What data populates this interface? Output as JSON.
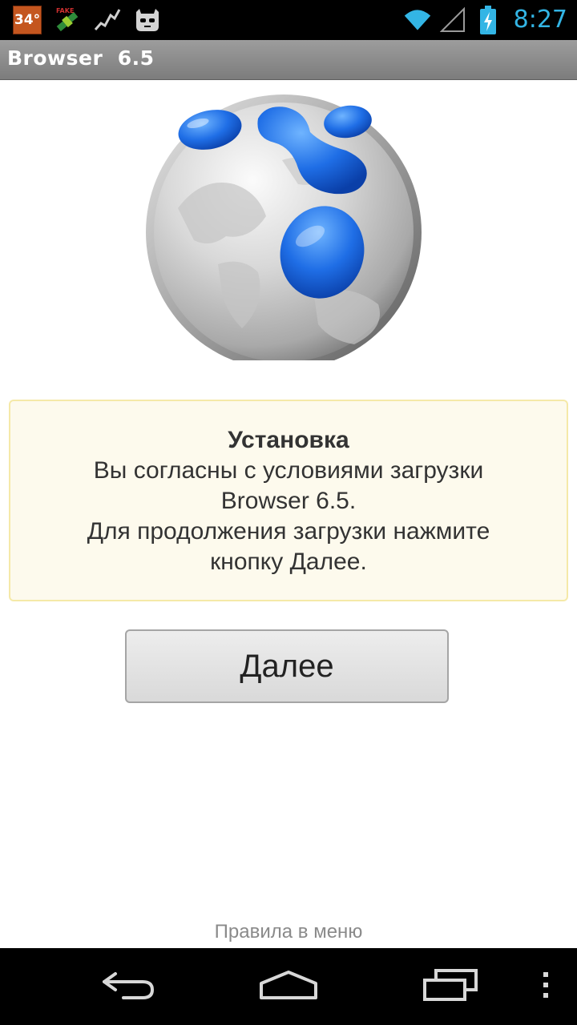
{
  "status_bar": {
    "temperature": "34°",
    "time": "8:27",
    "icons": [
      "temperature-badge",
      "fake-gps-satellite-icon",
      "activity-graph-icon",
      "cyanogenmod-mascot-icon",
      "wifi-icon",
      "cell-signal-icon",
      "battery-charging-icon"
    ]
  },
  "app": {
    "title": "Browser  6.5"
  },
  "info": {
    "title": "Установка",
    "lines": [
      "Вы согласны с условиями загрузки",
      "Browser 6.5.",
      "Для продолжения загрузки нажмите",
      "кнопку Далее."
    ]
  },
  "actions": {
    "next_label": "Далее"
  },
  "footer": {
    "rules_hint": "Правила в меню"
  },
  "nav": {
    "icons": [
      "back-icon",
      "home-icon",
      "recent-apps-icon",
      "menu-icon"
    ]
  },
  "colors": {
    "clock": "#33b5e5",
    "panel_background": "#fdfaed",
    "panel_border": "#f5e9a8",
    "logo_blue": "#1f6ee6"
  }
}
